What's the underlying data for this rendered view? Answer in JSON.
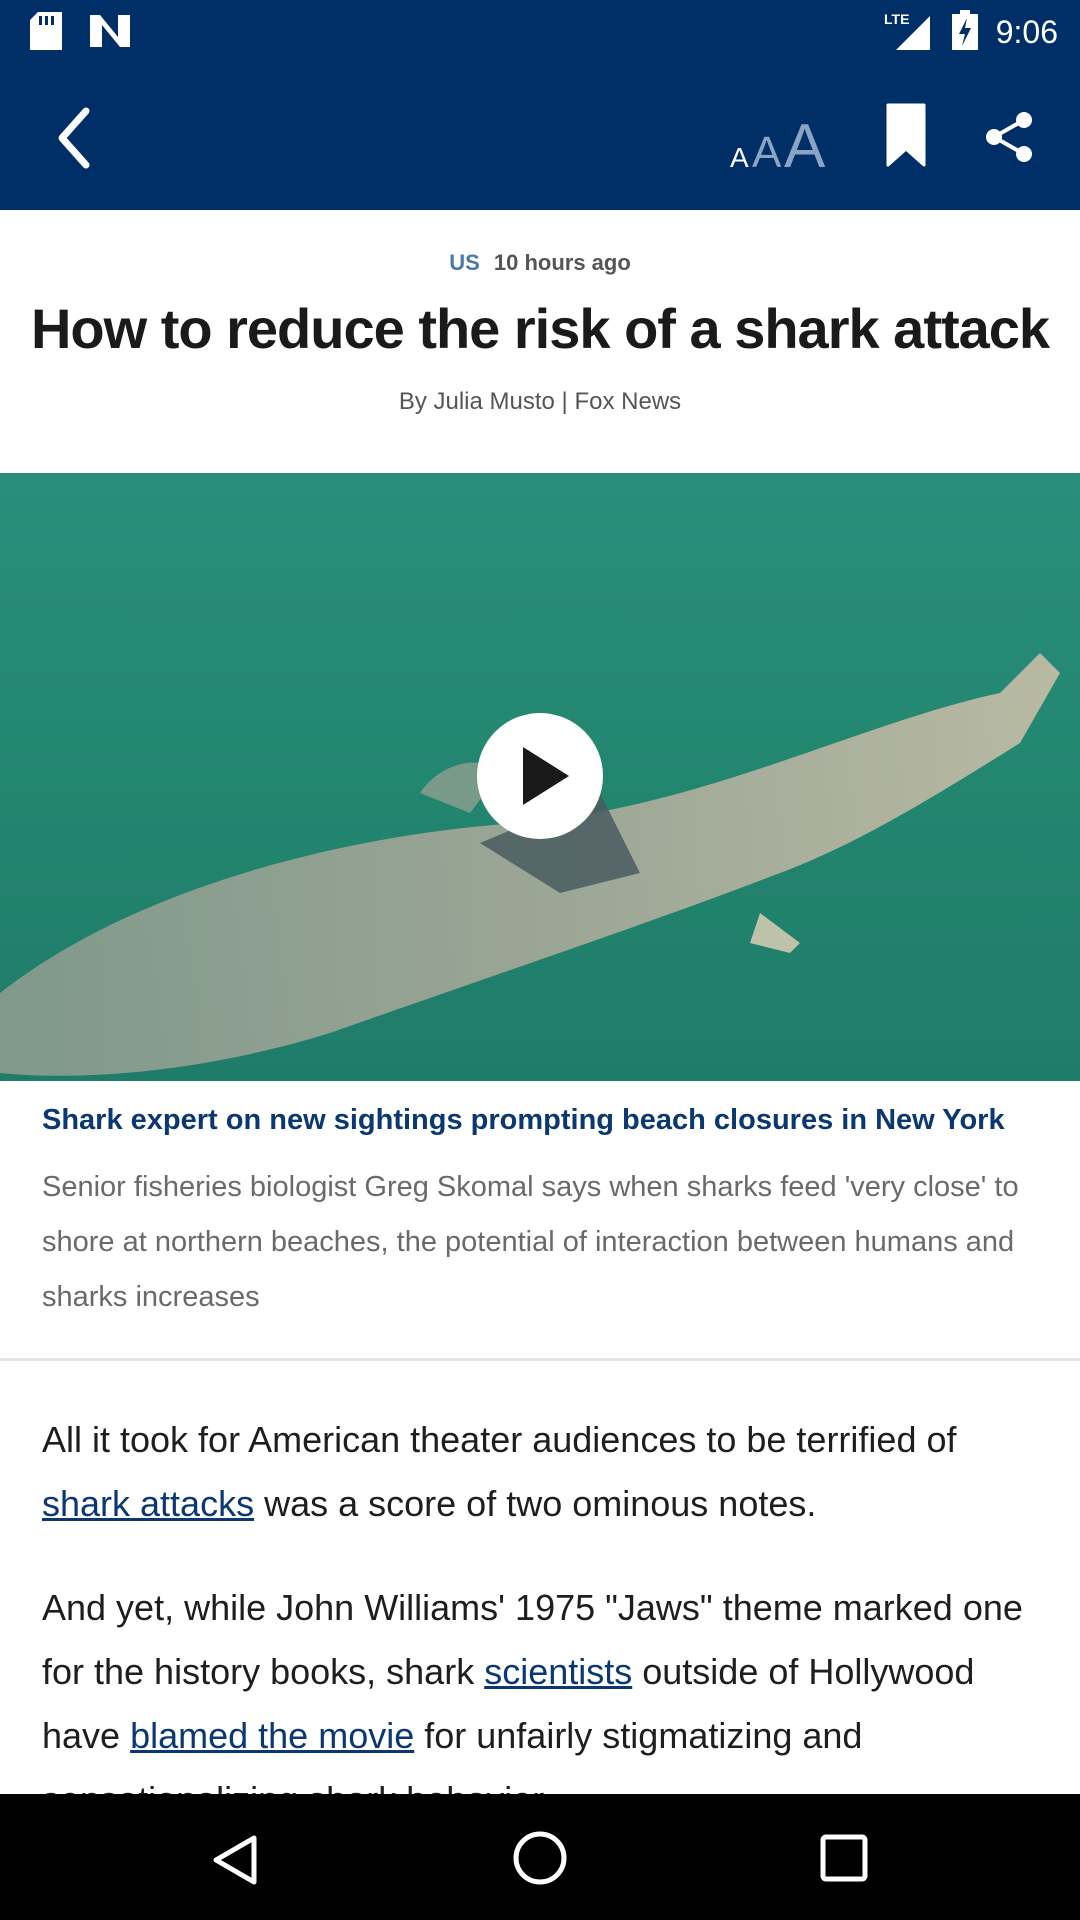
{
  "status_bar": {
    "time": "9:06",
    "network": "LTE",
    "icons": [
      "sd-card-icon",
      "n-notification-icon",
      "lte-signal-icon",
      "battery-charging-icon"
    ]
  },
  "app_bar": {
    "background_color": "#002e66",
    "icons": [
      "back-arrow-icon",
      "font-size-icon",
      "bookmark-icon",
      "share-icon"
    ]
  },
  "article": {
    "section": "US",
    "time_ago": "10 hours ago",
    "title": "How to reduce the risk of a shark attack",
    "byline": "By Julia Musto | Fox News",
    "video": {
      "caption_title": "Shark expert on new sightings prompting beach closures in New York",
      "caption_desc": "Senior fisheries biologist Greg Skomal says when sharks feed 'very close' to shore at northern beaches, the potential of interaction between humans and sharks increases"
    },
    "p1_before": "All it took for American theater audiences to be terrified of ",
    "p1_link": "shark attacks",
    "p1_after": " was a score of two ominous notes.",
    "p2_a": "And yet, while John Williams' 1975 \"Jaws\" theme marked one for the history books, shark ",
    "p2_link1": "scientists",
    "p2_b": " outside of Hollywood have ",
    "p2_link2": "blamed the movie",
    "p2_c": " for unfairly stigmatizing and sensationalizing shark behavior."
  },
  "colors": {
    "brand_navy": "#002e66",
    "section_blue": "#4b79a8",
    "link_navy": "#0b3870"
  }
}
